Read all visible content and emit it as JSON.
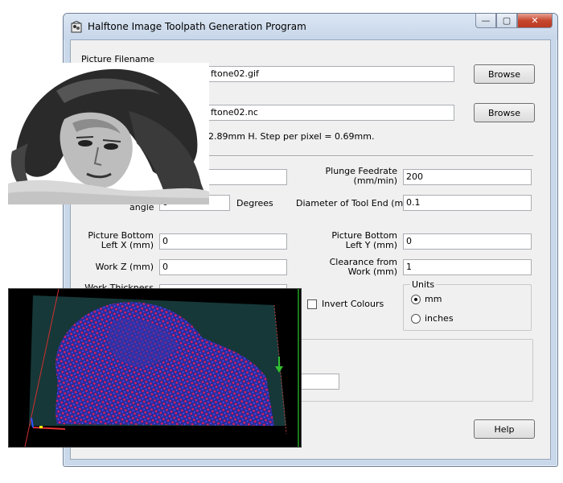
{
  "window": {
    "title": "Halftone Image Toolpath Generation Program",
    "close_glyph": "✕",
    "minimize_glyph": "—",
    "maximize_glyph": "▢"
  },
  "picture": {
    "label": "Picture Filename",
    "value": "ftone02.gif",
    "browse_label": "Browse"
  },
  "output": {
    "value": "ftone02.nc",
    "browse_label": "Browse"
  },
  "info_text": "2.89mm H. Step per pixel = 0.69mm.",
  "fields": {
    "angle_label": "angle",
    "angle_value": "0",
    "degrees_label": "Degrees",
    "plunge_label_1": "Plunge Feedrate",
    "plunge_label_2": "(mm/min)",
    "plunge_value": "200",
    "diameter_label": "Diameter of Tool End (mm)",
    "diameter_value": "0.1",
    "pbl_x_label_1": "Picture Bottom",
    "pbl_x_label_2": "Left X (mm)",
    "pbl_x_value": "0",
    "pbl_y_label_1": "Picture Bottom",
    "pbl_y_label_2": "Left Y (mm)",
    "pbl_y_value": "0",
    "workz_label": "Work Z (mm)",
    "workz_value": "0",
    "clearance_label_1": "Clearance from",
    "clearance_label_2": "Work (mm)",
    "clearance_value": "1",
    "thickness_label": "Work Thickness",
    "thickness_value": "",
    "bottom_value": ""
  },
  "invert": {
    "label": "Invert Colours",
    "checked": false
  },
  "units": {
    "legend": "Units",
    "options": [
      "mm",
      "inches"
    ],
    "selected": "mm"
  },
  "help_label": "Help"
}
